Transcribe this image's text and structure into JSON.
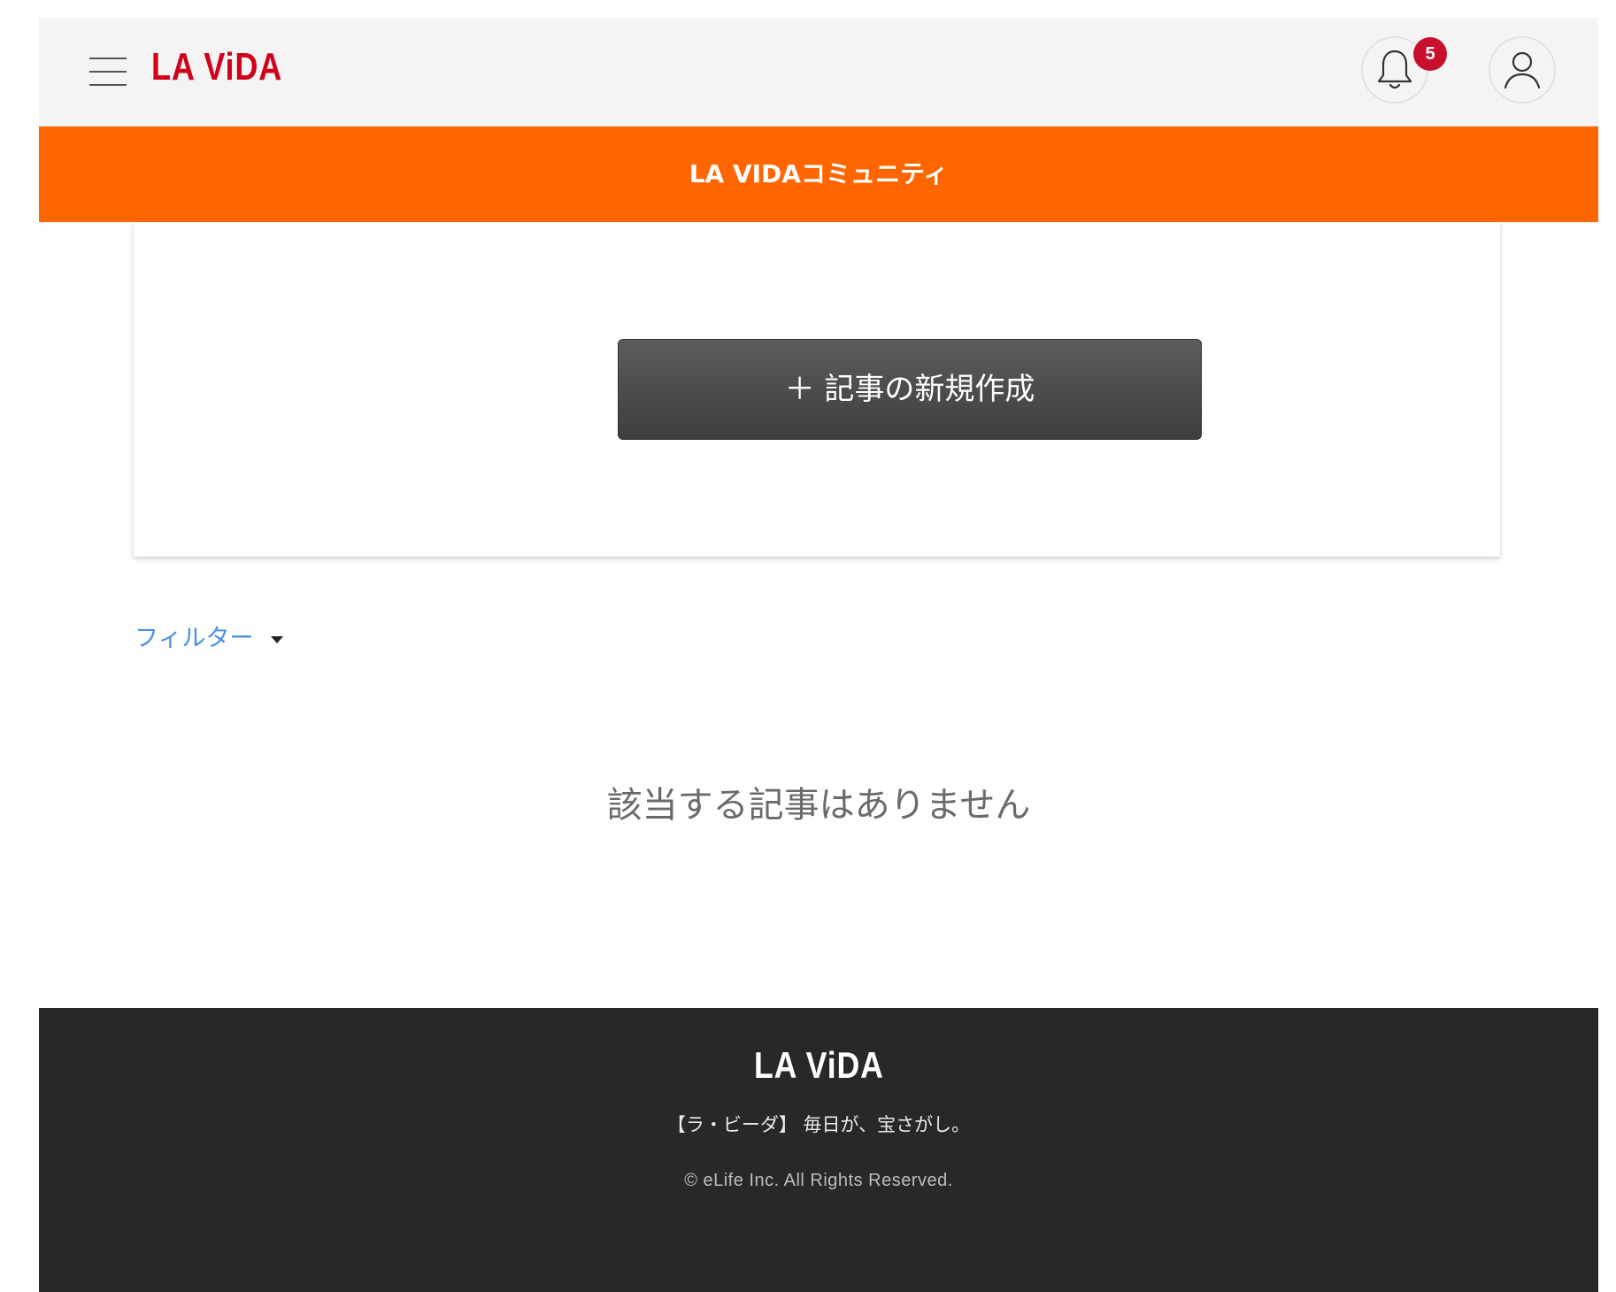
{
  "header": {
    "brand": "LA ViDA",
    "notifications": {
      "count": "5",
      "icon": "bell-icon"
    },
    "profile": {
      "icon": "user-icon"
    },
    "menu": {
      "icon": "hamburger-menu-icon"
    }
  },
  "banner": {
    "title": "LA VIDAコミュニティ"
  },
  "composer": {
    "create_label": "＋ 記事の新規作成"
  },
  "filter": {
    "label": "フィルター",
    "icon": "caret-down-icon"
  },
  "articles": {
    "empty_message": "該当する記事はありません"
  },
  "footer": {
    "brand": "LA ViDA",
    "tagline": "【ラ・ビーダ】 毎日が、宝さがし。",
    "copyright": "© eLife Inc. All Rights Reserved."
  },
  "colors": {
    "brand_red": "#d0021b",
    "banner_orange": "#ff6600",
    "badge_red": "#c8102e",
    "footer_bg": "#282828",
    "link_blue": "#4a90e2"
  }
}
